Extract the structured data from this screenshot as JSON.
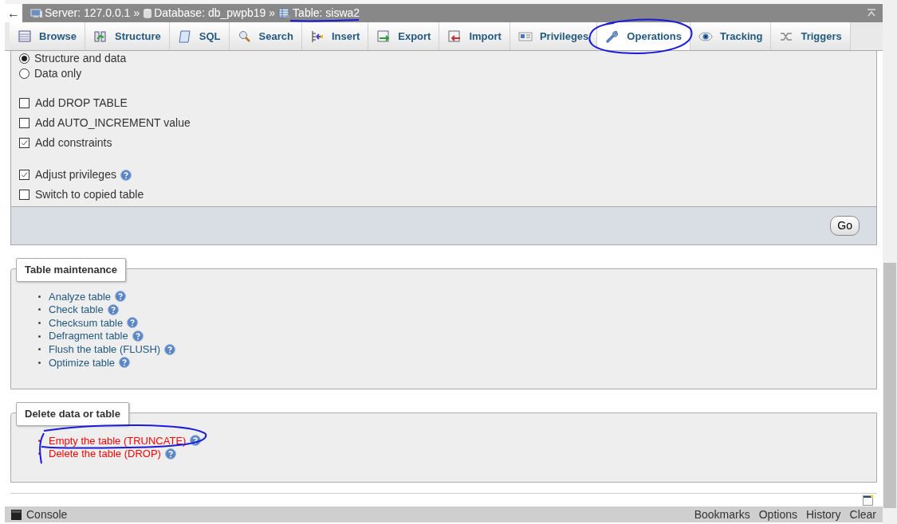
{
  "breadcrumb": {
    "back": "←",
    "items": [
      {
        "kind": "crumb",
        "label": "Server: 127.0.0.1"
      },
      {
        "kind": "separator",
        "label": "»"
      },
      {
        "kind": "crumb",
        "label": "Database: db_pwpb19"
      },
      {
        "kind": "separator",
        "label": "»"
      },
      {
        "kind": "crumb",
        "label": "Table: siswa2"
      }
    ]
  },
  "tabs": [
    {
      "label": "Browse",
      "selected": false
    },
    {
      "label": "Structure",
      "selected": false
    },
    {
      "label": "SQL",
      "selected": false
    },
    {
      "label": "Search",
      "selected": false
    },
    {
      "label": "Insert",
      "selected": false
    },
    {
      "label": "Export",
      "selected": false
    },
    {
      "label": "Import",
      "selected": false
    },
    {
      "label": "Privileges",
      "selected": false
    },
    {
      "label": "Operations",
      "selected": true
    },
    {
      "label": "Tracking",
      "selected": false
    },
    {
      "label": "Triggers",
      "selected": false
    }
  ],
  "copy_table": {
    "radios": [
      {
        "label": "Structure and data",
        "selected": true
      },
      {
        "label": "Data only",
        "selected": false
      }
    ],
    "options": [
      {
        "label": "Add DROP TABLE",
        "checked": false,
        "help": false
      },
      {
        "label": "Add AUTO_INCREMENT value",
        "checked": false,
        "help": false
      },
      {
        "label": "Add constraints",
        "checked": true,
        "help": false
      }
    ],
    "privileges": [
      {
        "label": "Adjust privileges",
        "checked": true,
        "help": true
      },
      {
        "label": "Switch to copied table",
        "checked": false,
        "help": false
      }
    ],
    "go_button": "Go"
  },
  "maintenance": {
    "legend": "Table maintenance",
    "items": [
      {
        "label": "Analyze table",
        "help": true
      },
      {
        "label": "Check table",
        "help": true
      },
      {
        "label": "Checksum table",
        "help": true
      },
      {
        "label": "Defragment table",
        "help": true
      },
      {
        "label": "Flush the table (FLUSH)",
        "help": true
      },
      {
        "label": "Optimize table",
        "help": true
      }
    ]
  },
  "delete": {
    "legend": "Delete data or table",
    "items": [
      {
        "label": "Empty the table (TRUNCATE)",
        "help": true
      },
      {
        "label": "Delete the table (DROP)",
        "help": true
      }
    ]
  },
  "console": {
    "label": "Console",
    "links": [
      "Bookmarks",
      "Options",
      "History",
      "Clear"
    ]
  }
}
